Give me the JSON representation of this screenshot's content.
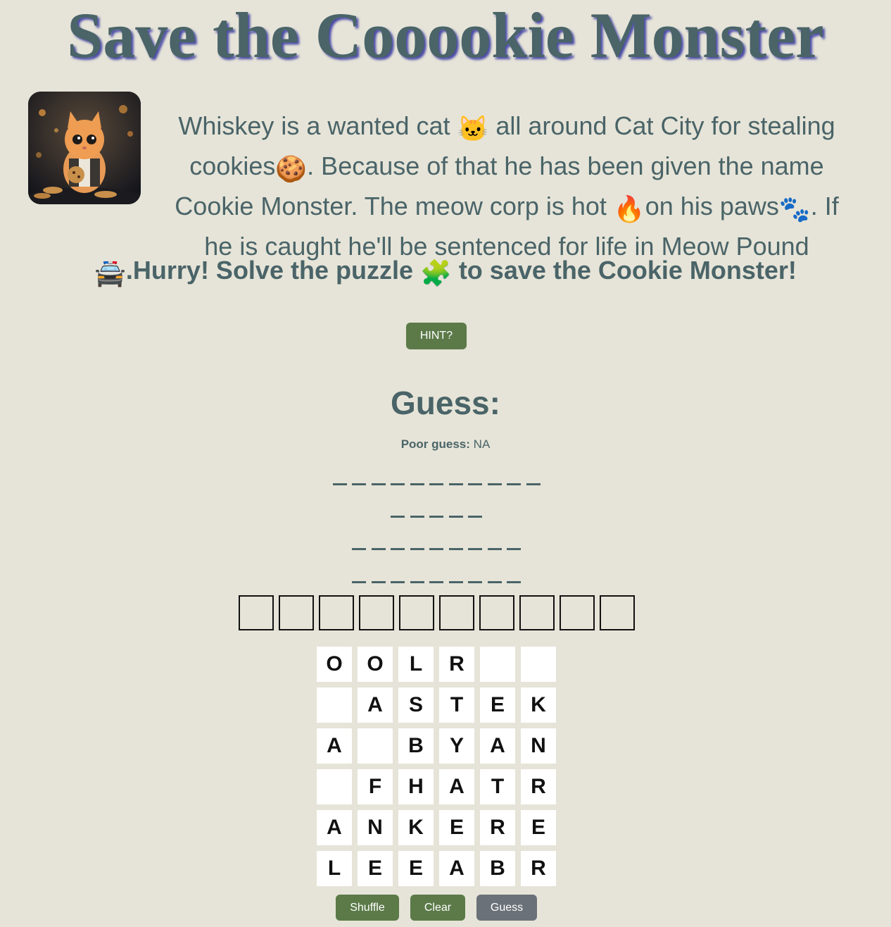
{
  "title": "Save the Cooookie Monster",
  "story": {
    "line1_a": "Whiskey is a wanted cat ",
    "line1_b": " all around Cat City for stealing",
    "line2_a": "cookies",
    "line2_b": ". Because of that he has been given the name",
    "line3_a": "Cookie Monster. The meow corp is hot ",
    "line3_b": "on his paws",
    "line3_c": ". If",
    "line4": "he is caught he'll be sentenced for life in Meow Pound",
    "hurry_a": ".Hurry! Solve the puzzle ",
    "hurry_b": " to save the Cookie Monster!"
  },
  "emoji": {
    "cat": "🐱",
    "cookie": "🍪",
    "fire": "🔥",
    "paws": "🐾",
    "police_car": "🚔",
    "puzzle": "🧩"
  },
  "hint_label": "HINT?",
  "guess_heading": "Guess:",
  "poor_guess": {
    "label": "Poor guess:",
    "value": "NA"
  },
  "word_blank_lengths": [
    11,
    5,
    9,
    9
  ],
  "answer_box_count": 10,
  "letter_grid": [
    [
      "O",
      "O",
      "L",
      "R",
      "",
      ""
    ],
    [
      "",
      "A",
      "S",
      "T",
      "E",
      "K"
    ],
    [
      "A",
      "",
      "B",
      "Y",
      "A",
      "N"
    ],
    [
      "",
      "F",
      "H",
      "A",
      "T",
      "R"
    ],
    [
      "A",
      "N",
      "K",
      "E",
      "R",
      "E"
    ],
    [
      "L",
      "E",
      "E",
      "A",
      "B",
      "R"
    ]
  ],
  "buttons": {
    "shuffle": "Shuffle",
    "clear": "Clear",
    "guess": "Guess"
  },
  "colors": {
    "background": "#e6e4d8",
    "text": "#4a6468",
    "primary_button": "#5b7a48",
    "disabled_button": "#6b7178"
  }
}
